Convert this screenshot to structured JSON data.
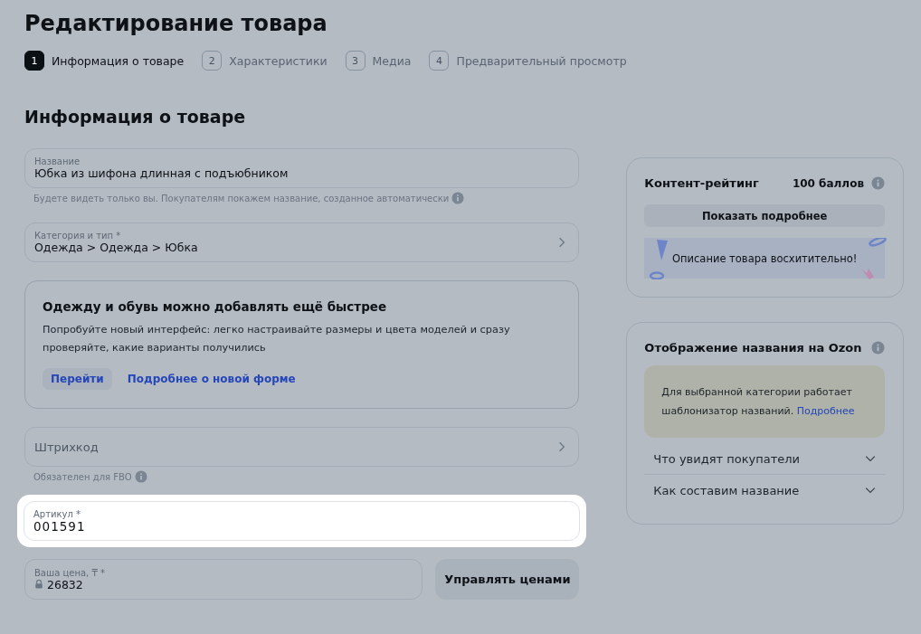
{
  "title": "Редактирование товара",
  "steps": [
    {
      "number": "1",
      "label": "Информация о товаре",
      "selected": true
    },
    {
      "number": "2",
      "label": "Характеристики",
      "selected": false
    },
    {
      "number": "3",
      "label": "Медиа",
      "selected": false
    },
    {
      "number": "4",
      "label": "Предварительный просмотр",
      "selected": false
    }
  ],
  "section_title": "Информация о товаре",
  "fields": [
    {
      "kind": "text",
      "label": "Название",
      "value": "Юбка из шифона длинная с подъюбником",
      "hint": "Будете видеть только вы. Покупателям покажем название, созданное автоматически",
      "hint_info": true
    },
    {
      "kind": "select",
      "label": "Категория и тип *",
      "value": "Одежда > Одежда > Юбка"
    },
    {
      "kind": "promo",
      "title": "Одежду и обувь можно добавлять ещё быстрее",
      "text": "Попробуйте новый интерфейс: легко настраивайте размеры и цвета моделей и сразу проверяйте, какие варианты получились",
      "actions": [
        {
          "kind": "button",
          "label": "Перейти"
        },
        {
          "kind": "link",
          "label": "Подробнее о новой форме"
        }
      ]
    },
    {
      "kind": "select",
      "placeholder": "Штрихкод",
      "hint": "Обязателен для FBO",
      "hint_info": true
    },
    {
      "kind": "text",
      "label": "Артикул *",
      "value": "001591",
      "highlighted": true
    },
    {
      "kind": "price",
      "label": "Ваша цена, ₸ *",
      "value": "26832",
      "locked": true,
      "button": "Управлять ценами"
    }
  ],
  "rating": {
    "title": "Контент-рейтинг",
    "score": "100 баллов",
    "button": "Показать подробнее",
    "banner": "Описание товара восхитительно!"
  },
  "naming": {
    "title": "Отображение названия на Ozon",
    "notice": "Для выбранной категории работает шаблонизатор названий.",
    "notice_link": "Подробнее",
    "sections": [
      {
        "label": "Что увидят покупатели",
        "expanded": false
      },
      {
        "label": "Как составим название",
        "expanded": false
      }
    ]
  }
}
